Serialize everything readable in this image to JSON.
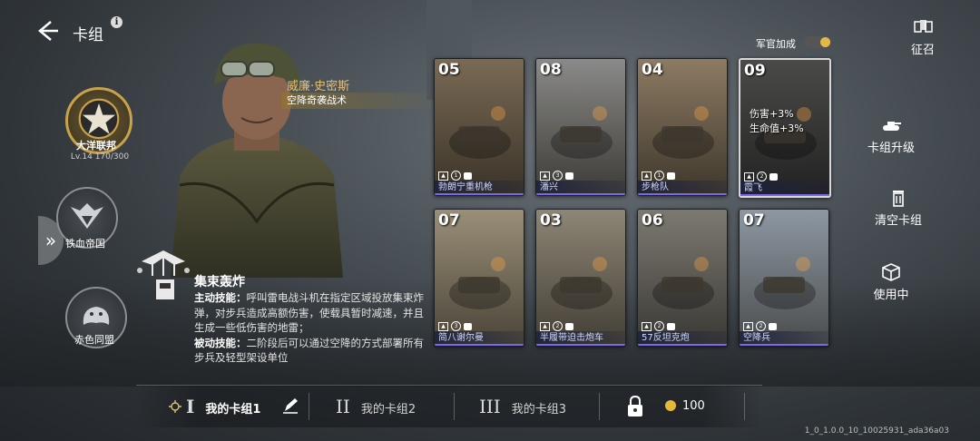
{
  "header": {
    "title": "卡组",
    "info_icon": "info-icon",
    "back_icon": "back-arrow-icon"
  },
  "factions": [
    {
      "name": "大洋联邦",
      "icon": "star-emblem-icon",
      "selected": true
    },
    {
      "name": "铁血帝国",
      "icon": "eagle-emblem-icon",
      "selected": false
    },
    {
      "name": "赤色同盟",
      "icon": "bear-emblem-icon",
      "selected": false
    }
  ],
  "level": "Lv.14  170/300",
  "commander": {
    "name": "威廉·史密斯",
    "tactic": "空降奇袭战术"
  },
  "skill": {
    "name": "集束轰炸",
    "active_label": "主动技能：",
    "active_text": "呼叫雷电战斗机在指定区域投放集束炸弹，对步兵造成高额伤害，使载具暂时减速，并且生成一些低伤害的地雷；",
    "passive_label": "被动技能：",
    "passive_text": "二阶段后可以通过空降的方式部署所有步兵及轻型架设单位"
  },
  "cards": [
    {
      "cost": "05",
      "name": "勃朗宁重机枪",
      "stat": "1",
      "kind": "mg"
    },
    {
      "cost": "08",
      "name": "潘兴",
      "stat": "3",
      "kind": "tank"
    },
    {
      "cost": "04",
      "name": "步枪队",
      "stat": "1",
      "kind": "rifle"
    },
    {
      "cost": "09",
      "name": "霞飞",
      "stat": "2",
      "kind": "dark",
      "buff1": "伤害+3%",
      "buff2": "生命值+3%"
    },
    {
      "cost": "07",
      "name": "简八谢尔曼",
      "stat": "3",
      "kind": "tank2"
    },
    {
      "cost": "03",
      "name": "半履带迫击炮车",
      "stat": "2",
      "kind": "truck"
    },
    {
      "cost": "06",
      "name": "57反坦克炮",
      "stat": "2",
      "kind": "gun"
    },
    {
      "cost": "07",
      "name": "空降兵",
      "stat": "2",
      "kind": "para"
    }
  ],
  "right": {
    "bonus_label": "军官加成",
    "recruit": "征召",
    "upgrade": "卡组升级",
    "clear": "清空卡组",
    "in_use": "使用中"
  },
  "decks": [
    {
      "num": "I",
      "label": "我的卡组1"
    },
    {
      "num": "II",
      "label": "我的卡组2"
    },
    {
      "num": "III",
      "label": "我的卡组3"
    }
  ],
  "price": "100",
  "version": "1_0_1.0.0_10_10025931_ada36a03",
  "colors": {
    "gold": "#e6c170",
    "accent_purple": "#7b6ae0"
  }
}
